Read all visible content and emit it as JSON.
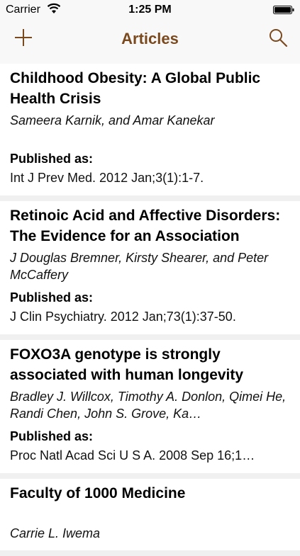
{
  "status_bar": {
    "carrier": "Carrier",
    "time": "1:25 PM"
  },
  "nav": {
    "title": "Articles",
    "add_icon": "plus-icon",
    "search_icon": "magnifier-icon",
    "title_color": "#7a4a1e"
  },
  "labels": {
    "published_as": "Published as:"
  },
  "articles": [
    {
      "title": "Childhood Obesity: A Global Public Health Crisis",
      "authors": "Sameera Karnik, and Amar Kanekar",
      "published": "Int J Prev Med. 2012 Jan;3(1):1-7."
    },
    {
      "title": "Retinoic Acid and Affective Disorders: The Evidence for an Association",
      "authors": "J Douglas Bremner, Kirsty Shearer, and Peter McCaffery",
      "published": "J Clin Psychiatry. 2012 Jan;73(1):37-50."
    },
    {
      "title": "FOXO3A genotype is strongly associated with human longevity",
      "authors": "Bradley J. Willcox, Timothy A. Donlon, Qimei He, Randi Chen, John S. Grove, Ka…",
      "published": "Proc Natl Acad Sci U S A. 2008 Sep 16;1…"
    },
    {
      "title": "Faculty of 1000 Medicine",
      "authors": "Carrie L. Iwema"
    }
  ]
}
